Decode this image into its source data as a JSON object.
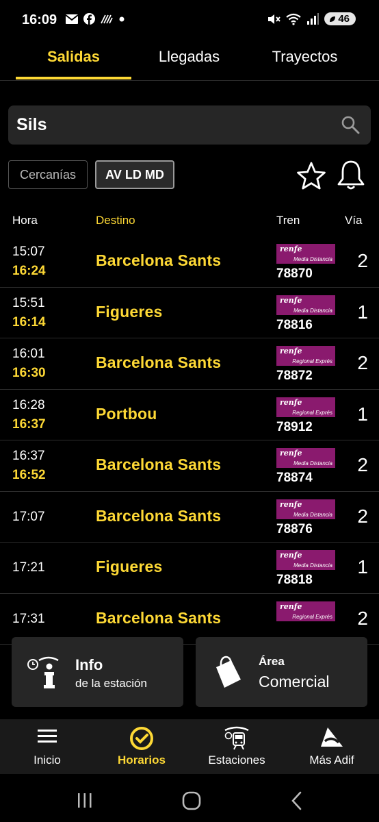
{
  "status_bar": {
    "time": "16:09",
    "battery": "46",
    "left_icons": [
      "mail-icon",
      "facebook-icon",
      "activity-icon",
      "dot-icon"
    ],
    "right_icons": [
      "mute-icon",
      "wifi-icon",
      "signal-icon"
    ]
  },
  "tabs": [
    {
      "label": "Salidas",
      "active": true
    },
    {
      "label": "Llegadas",
      "active": false
    },
    {
      "label": "Trayectos",
      "active": false
    }
  ],
  "search": {
    "value": "Sils"
  },
  "filters": {
    "cercanias": "Cercanías",
    "av": "AV LD MD"
  },
  "table": {
    "headers": {
      "hora": "Hora",
      "destino": "Destino",
      "tren": "Tren",
      "via": "Vía"
    },
    "rows": [
      {
        "sched": "15:07",
        "est": "16:24",
        "dest": "Barcelona Sants",
        "brand": "renfe",
        "service": "Media Distancia",
        "train": "78870",
        "via": "2"
      },
      {
        "sched": "15:51",
        "est": "16:14",
        "dest": "Figueres",
        "brand": "renfe",
        "service": "Media Distancia",
        "train": "78816",
        "via": "1"
      },
      {
        "sched": "16:01",
        "est": "16:30",
        "dest": "Barcelona Sants",
        "brand": "renfe",
        "service": "Regional Exprés",
        "train": "78872",
        "via": "2"
      },
      {
        "sched": "16:28",
        "est": "16:37",
        "dest": "Portbou",
        "brand": "renfe",
        "service": "Regional Exprés",
        "train": "78912",
        "via": "1"
      },
      {
        "sched": "16:37",
        "est": "16:52",
        "dest": "Barcelona Sants",
        "brand": "renfe",
        "service": "Media Distancia",
        "train": "78874",
        "via": "2"
      },
      {
        "sched": "17:07",
        "est": "",
        "dest": "Barcelona Sants",
        "brand": "renfe",
        "service": "Media Distancia",
        "train": "78876",
        "via": "2"
      },
      {
        "sched": "17:21",
        "est": "",
        "dest": "Figueres",
        "brand": "renfe",
        "service": "Media Distancia",
        "train": "78818",
        "via": "1"
      },
      {
        "sched": "17:31",
        "est": "",
        "dest": "Barcelona Sants",
        "brand": "renfe",
        "service": "Regional Exprés",
        "train": "",
        "via": "2"
      }
    ]
  },
  "cards": {
    "info": {
      "title": "Info",
      "subtitle": "de la estación"
    },
    "area": {
      "title": "Área",
      "subtitle": "Comercial"
    }
  },
  "bottom_nav": [
    {
      "label": "Inicio",
      "icon": "menu-icon",
      "active": false
    },
    {
      "label": "Horarios",
      "icon": "clock-icon",
      "active": true
    },
    {
      "label": "Estaciones",
      "icon": "train-station-icon",
      "active": false
    },
    {
      "label": "Más Adif",
      "icon": "adif-logo-icon",
      "active": false
    }
  ],
  "colors": {
    "accent": "#fdd835",
    "renfe": "#8a1a6e",
    "background": "#000000"
  }
}
